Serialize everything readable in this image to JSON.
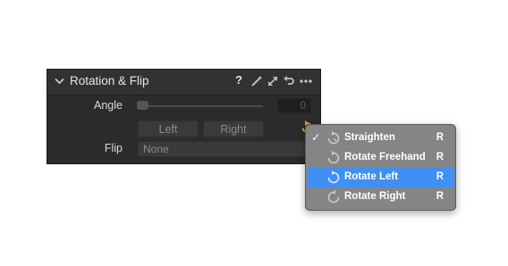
{
  "panel": {
    "title": "Rotation & Flip",
    "help_label": "?",
    "header_icons": [
      "chevron-down-icon",
      "help-icon",
      "pen-icon",
      "expand-icon",
      "reset-icon",
      "more-icon"
    ],
    "angle_label": "Angle",
    "angle_value": "0",
    "left_button": "Left",
    "right_button": "Right",
    "flip_label": "Flip",
    "flip_value": "None",
    "accent_color": "#f0a030"
  },
  "menu": {
    "items": [
      {
        "label": "Straighten",
        "shortcut": "R",
        "checked": true,
        "selected": false,
        "icon": "straighten-icon"
      },
      {
        "label": "Rotate Freehand",
        "shortcut": "R",
        "checked": false,
        "selected": false,
        "icon": "rotate-freehand-icon"
      },
      {
        "label": "Rotate Left",
        "shortcut": "R",
        "checked": false,
        "selected": true,
        "icon": "rotate-left-icon"
      },
      {
        "label": "Rotate Right",
        "shortcut": "R",
        "checked": false,
        "selected": false,
        "icon": "rotate-right-icon"
      }
    ],
    "check_mark": "✓",
    "selection_color": "#3f8ff5"
  }
}
